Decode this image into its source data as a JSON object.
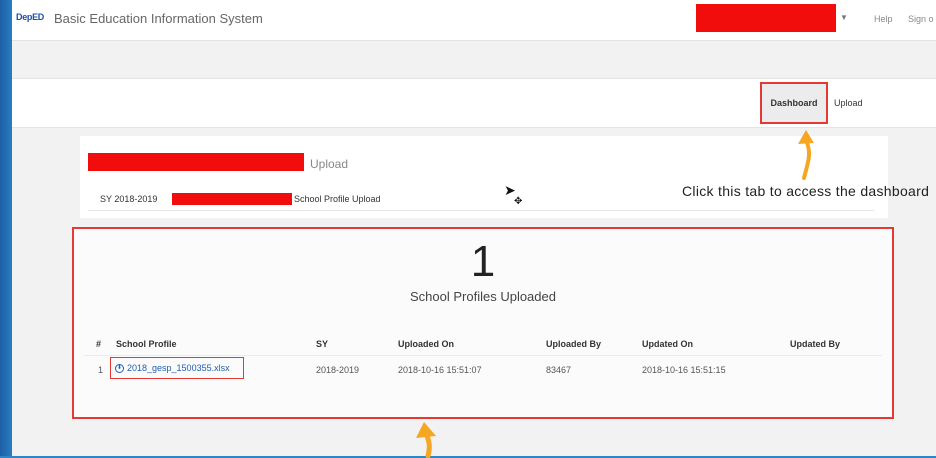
{
  "navbar": {
    "logo_text": "DepED",
    "title": "Basic Education Information System",
    "help": "Help",
    "sign_out": "Sign o"
  },
  "tabs": [
    {
      "label": "Dashboard",
      "active": true
    },
    {
      "label": "Upload",
      "active": false
    }
  ],
  "upload_panel": {
    "heading_suffix": "Upload",
    "sy_label": "SY 2018-2019",
    "doc_type": "School Profile Upload"
  },
  "callout": {
    "text": "Click this tab to access the dashboard"
  },
  "summary": {
    "count": "1",
    "label": "School Profiles Uploaded"
  },
  "table": {
    "columns": [
      "#",
      "School Profile",
      "SY",
      "Uploaded On",
      "Uploaded By",
      "Updated On",
      "Updated By"
    ],
    "rows": [
      {
        "num": "1",
        "file": "2018_gesp_1500355.xlsx",
        "sy": "2018-2019",
        "uploaded_on": "2018-10-16 15:51:07",
        "uploaded_by": "83467",
        "updated_on": "2018-10-16 15:51:15",
        "updated_by": ""
      }
    ]
  },
  "colors": {
    "highlight_red": "#e53935",
    "redaction_red": "#f20d0d",
    "arrow_orange": "#f5a623",
    "link_blue": "#1e5fb4"
  }
}
